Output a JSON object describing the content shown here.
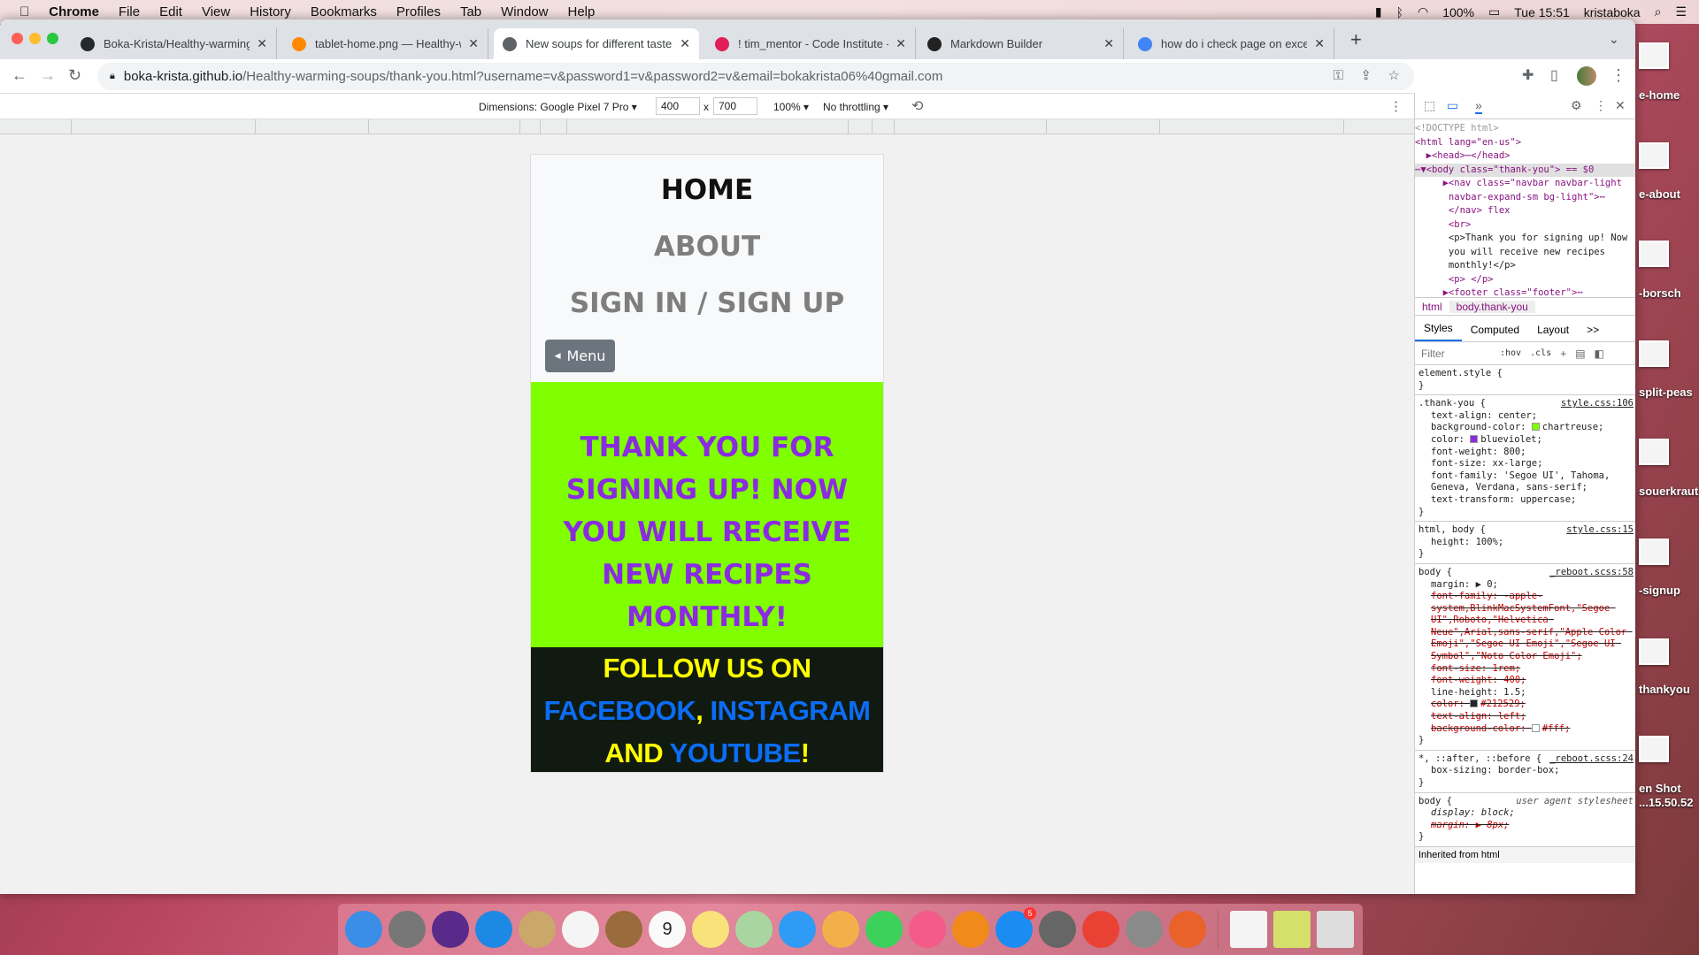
{
  "menubar": {
    "app": "Chrome",
    "items": [
      "File",
      "Edit",
      "View",
      "History",
      "Bookmarks",
      "Profiles",
      "Tab",
      "Window",
      "Help"
    ],
    "battery": "100%",
    "clock": "Tue 15:51",
    "user": "kristaboka"
  },
  "tabs": [
    {
      "label": "Boka-Krista/Healthy-warming-soups",
      "icon": "github-icon",
      "color": "#24292e"
    },
    {
      "label": "tablet-home.png — Healthy-warming",
      "icon": "gitpod-icon",
      "color": "#ff8a00"
    },
    {
      "label": "New soups for different tastes",
      "icon": "globe-icon",
      "color": "#5f6368",
      "active": true
    },
    {
      "label": "! tim_mentor - Code Institute - Slack",
      "icon": "slack-icon",
      "color": "#e01e5a"
    },
    {
      "label": "Markdown Builder",
      "icon": "markdown-icon",
      "color": "#222"
    },
    {
      "label": "how do i check page on excel size",
      "icon": "google-icon",
      "color": "#4285f4"
    }
  ],
  "address": {
    "host": "boka-krista.github.io",
    "path": "/Healthy-warming-soups/thank-you.html?username=v&password1=v&password2=v&email=bokakrista06%40gmail.com"
  },
  "device_toolbar": {
    "dimensions": "Dimensions: Google Pixel 7 Pro ▾",
    "width": "400",
    "x": "x",
    "height": "700",
    "zoom": "100% ▾",
    "throttling": "No throttling ▾"
  },
  "page": {
    "nav": {
      "home": "HOME",
      "about": "ABOUT",
      "signin": "SIGN IN / SIGN UP",
      "menu": "Menu"
    },
    "thanks": "Thank you for signing up! Now you will receive new recipes monthly!",
    "footer": {
      "text1": "FOLLOW US ON",
      "facebook": "FACEBOOK",
      "comma": ",",
      "instagram": "INSTAGRAM",
      "and": "AND",
      "youtube": "YOUTUBE",
      "bang": "!"
    }
  },
  "devtools": {
    "dom": [
      "<!DOCTYPE html>",
      "<html lang=\"en-us\">",
      "  ▶<head>⋯</head>",
      "⋯▼<body class=\"thank-you\"> == $0",
      "     ▶<nav class=\"navbar navbar-light",
      "      navbar-expand-sm bg-light\">⋯",
      "      </nav> flex",
      "      <br>",
      "      <p>Thank you for signing up! Now",
      "      you will receive new recipes",
      "      monthly!</p>",
      "      <p> </p>",
      "     ▶<footer class=\"footer\">⋯"
    ],
    "crumbs": [
      "html",
      "body.thank-you"
    ],
    "tabs": [
      "Styles",
      "Computed",
      "Layout",
      ">>"
    ],
    "filter": "Filter",
    "hov": ":hov",
    "cls": ".cls",
    "rules": [
      {
        "selector": "element.style {",
        "source": "",
        "props": []
      },
      {
        "selector": ".thank-you {",
        "source": "style.css:106",
        "props": [
          {
            "t": "text-align: center;"
          },
          {
            "t": "background-color: chartreuse;",
            "sw": "#7fff00"
          },
          {
            "t": "color: blueviolet;",
            "sw": "#8a2be2"
          },
          {
            "t": "font-weight: 800;"
          },
          {
            "t": "font-size: xx-large;"
          },
          {
            "t": "font-family: 'Segoe UI', Tahoma, Geneva, Verdana, sans-serif;"
          },
          {
            "t": "text-transform: uppercase;"
          }
        ]
      },
      {
        "selector": "html, body {",
        "source": "style.css:15",
        "props": [
          {
            "t": "height: 100%;"
          }
        ]
      },
      {
        "selector": "body {",
        "source": "_reboot.scss:58",
        "props": [
          {
            "t": "margin: ▶ 0;"
          },
          {
            "t": "font-family: -apple-system,BlinkMacSystemFont,\"Segoe UI\",Roboto,\"Helvetica Neue\",Arial,sans-serif,\"Apple Color Emoji\",\"Segoe UI Emoji\",\"Segoe UI Symbol\",\"Noto Color Emoji\";",
            "s": true
          },
          {
            "t": "font-size: 1rem;",
            "s": true
          },
          {
            "t": "font-weight: 400;",
            "s": true
          },
          {
            "t": "line-height: 1.5;"
          },
          {
            "t": "color: #212529;",
            "s": true,
            "sw": "#212529"
          },
          {
            "t": "text-align: left;",
            "s": true
          },
          {
            "t": "background-color: #fff;",
            "s": true,
            "sw": "#ffffff"
          }
        ]
      },
      {
        "selector": "*, ::after, ::before {",
        "source": "_reboot.scss:24",
        "props": [
          {
            "t": "box-sizing: border-box;"
          }
        ]
      },
      {
        "selector": "body {",
        "source": "user agent stylesheet",
        "ua": true,
        "props": [
          {
            "t": "display: block;",
            "i": true
          },
          {
            "t": "margin: ▶ 8px;",
            "i": true,
            "s": true
          }
        ]
      }
    ],
    "inherited": "Inherited from html"
  },
  "desktop": {
    "labels": [
      "e-home",
      "e-about",
      "-borsch",
      "split-peas",
      "souerkraut",
      "-signup",
      "thankyou",
      "en Shot",
      "...15.50.52"
    ]
  },
  "dock": [
    {
      "n": "finder-icon",
      "c": "#3a8ee6"
    },
    {
      "n": "launchpad-icon",
      "c": "#777"
    },
    {
      "n": "siri-icon",
      "c": "#5a2a8a"
    },
    {
      "n": "safari-icon",
      "c": "#1e88e5"
    },
    {
      "n": "mail-icon",
      "c": "#c9a86a"
    },
    {
      "n": "reminders-icon",
      "c": "#f5f5f5"
    },
    {
      "n": "contacts-icon",
      "c": "#9a6b3c"
    },
    {
      "n": "calendar-icon",
      "c": "#fafafa",
      "t": "9"
    },
    {
      "n": "notes-icon",
      "c": "#f9e27a"
    },
    {
      "n": "maps-icon",
      "c": "#a9d6a0"
    },
    {
      "n": "messages-icon",
      "c": "#2f9bf5"
    },
    {
      "n": "photos-icon",
      "c": "#f3b04a"
    },
    {
      "n": "facetime-icon",
      "c": "#3bd15a"
    },
    {
      "n": "music-icon",
      "c": "#f45a8a"
    },
    {
      "n": "books-icon",
      "c": "#f08a1a"
    },
    {
      "n": "app-store-icon",
      "c": "#1b8cf2",
      "badge": "5"
    },
    {
      "n": "system-preferences-icon",
      "c": "#666"
    },
    {
      "n": "chrome-icon",
      "c": "#e94235"
    },
    {
      "n": "clock-app-icon",
      "c": "#8a8a8a"
    },
    {
      "n": "firefox-icon",
      "c": "#e8622a"
    },
    {
      "n": "document-stack-icon",
      "c": "#f4f4f4"
    },
    {
      "n": "downloads-stack-icon",
      "c": "#d4e06a"
    },
    {
      "n": "trash-icon",
      "c": "#ddd"
    }
  ]
}
